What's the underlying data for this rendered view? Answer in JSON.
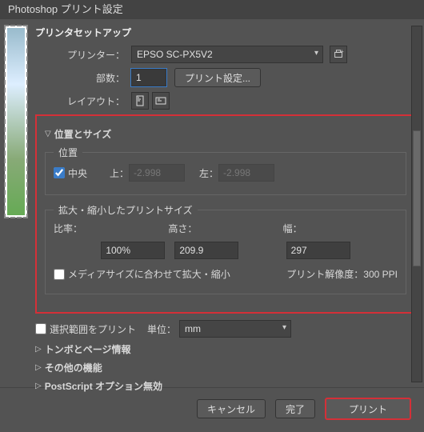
{
  "title": "Photoshop プリント設定",
  "setup": {
    "heading": "プリンタセットアップ",
    "printer_label": "プリンター：",
    "printer_value": "EPSO SC-PX5V2",
    "copies_label": "部数：",
    "copies_value": "1",
    "print_settings_btn": "プリント設定...",
    "layout_label": "レイアウト："
  },
  "pos": {
    "heading": "位置とサイズ",
    "position_legend": "位置",
    "center_label": "中央",
    "top_label": "上：",
    "top_value": "-2.998",
    "left_label": "左：",
    "left_value": "-2.998",
    "scaled_legend": "拡大・縮小したプリントサイズ",
    "ratio_label": "比率：",
    "ratio_value": "100%",
    "height_label": "高さ：",
    "height_value": "209.9",
    "width_label": "幅：",
    "width_value": "297",
    "fit_media_label": "メディアサイズに合わせて拡大・縮小",
    "resolution_label": "プリント解像度：300 PPI"
  },
  "misc": {
    "print_selection_label": "選択範囲をプリント",
    "unit_label": "単位：",
    "unit_value": "mm",
    "marks_heading": "トンボとページ情報",
    "other_heading": "その他の機能",
    "postscript_heading": "PostScript オプション無効"
  },
  "footer": {
    "cancel": "キャンセル",
    "done": "完了",
    "print": "プリント"
  }
}
